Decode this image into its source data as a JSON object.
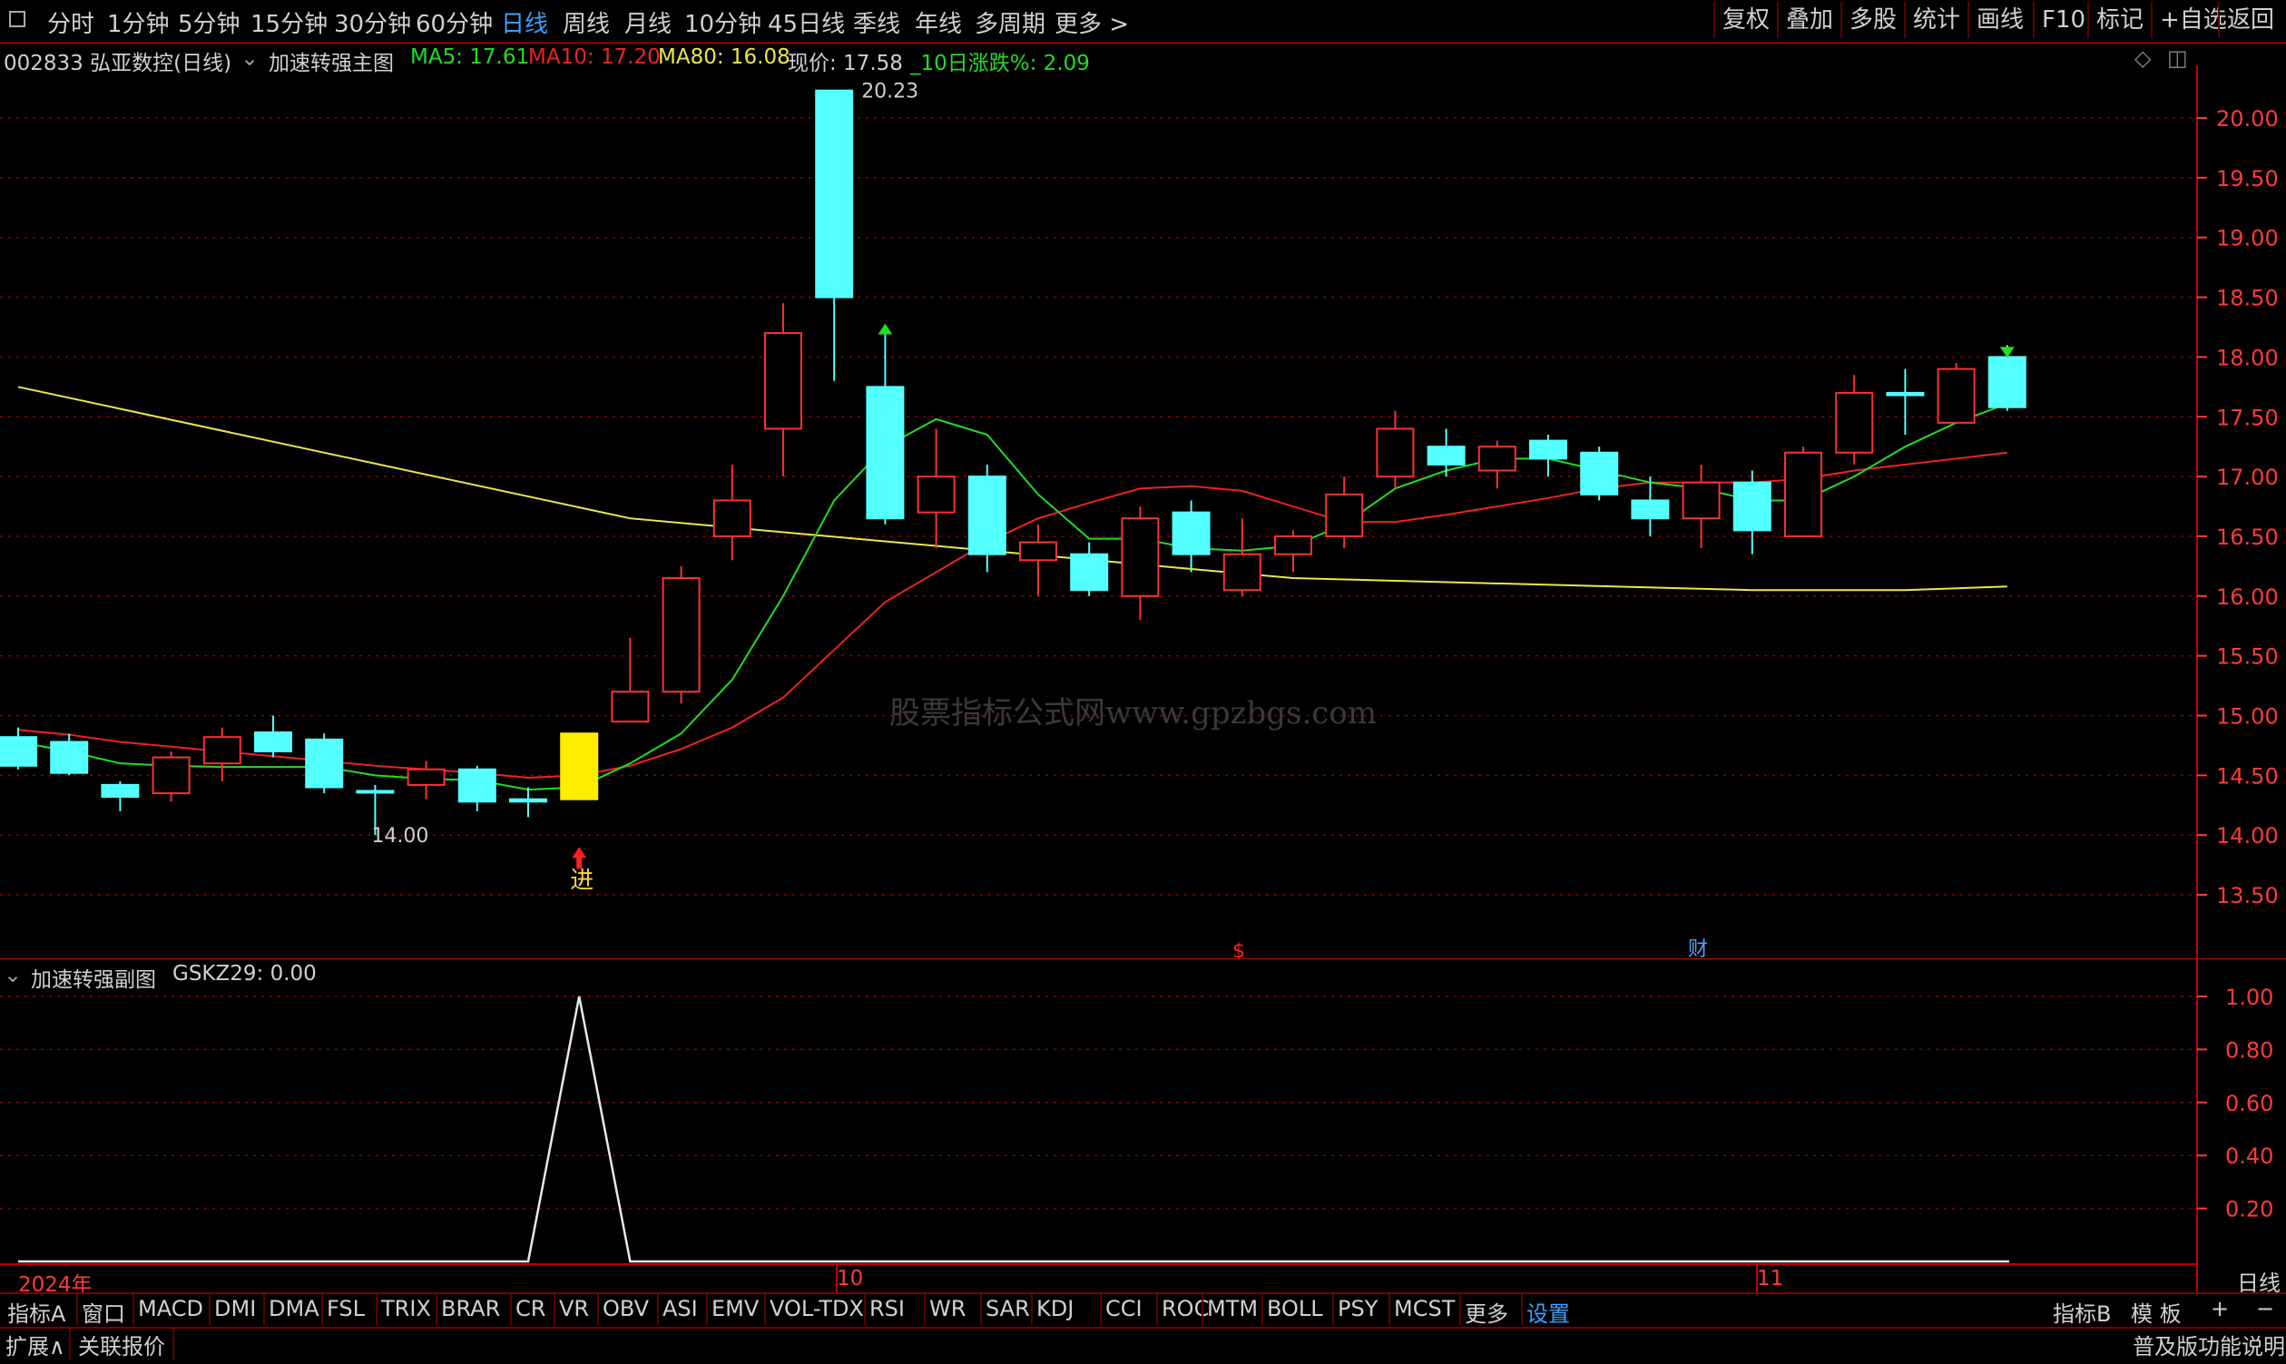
{
  "toolbar": {
    "periods": [
      "分时",
      "1分钟",
      "5分钟",
      "15分钟",
      "30分钟",
      "60分钟",
      "日线",
      "周线",
      "月线",
      "10分钟",
      "45日线",
      "季线",
      "年线",
      "多周期",
      "更多 >"
    ],
    "active_period": "日线",
    "right": [
      "复权",
      "叠加",
      "多股",
      "统计",
      "画线",
      "F10",
      "标记",
      "+自选",
      "返回"
    ]
  },
  "info": {
    "stock": "002833 弘亚数控(日线)",
    "formula": "加速转强主图",
    "ma5": "MA5: 17.61",
    "ma10": "MA10: 17.20",
    "ma80": "MA80: 16.08",
    "price": "现价: 17.58",
    "change": "_10日涨跌%: 2.09"
  },
  "colors": {
    "up": "#ff3030",
    "down": "#54ffff",
    "ma5": "#22dd22",
    "ma10": "#ee2222",
    "ma80": "#e8e84a",
    "grid": "#8a0000",
    "axis": "#ff3a3a",
    "signal": "#ffee00"
  },
  "annotations": {
    "high": "20.23",
    "low": "←14.00",
    "buy_label": "进",
    "event_s": "$",
    "event_cai": "财",
    "watermark": "股票指标公式网www.gpzbgs.com"
  },
  "sub": {
    "title": "加速转强副图",
    "value": "GSKZ29: 0.00"
  },
  "xaxis": {
    "year": "2024年",
    "oct": "10",
    "nov": "11",
    "period": "日线"
  },
  "tabs": [
    "指标A",
    "窗口",
    "MACD",
    "DMI",
    "DMA",
    "FSL",
    "TRIX",
    "BRAR",
    "CR",
    "VR",
    "OBV",
    "ASI",
    "EMV",
    "VOL-TDX",
    "RSI",
    "WR",
    "SAR",
    "KDJ",
    "CCI",
    "ROC",
    "MTM",
    "BOLL",
    "PSY",
    "MCST",
    "更多",
    "设置"
  ],
  "tab_right": [
    "指标B",
    "模 板",
    "+",
    "−"
  ],
  "status": {
    "expand": "扩展∧",
    "linked": "关联报价",
    "right": "普及版功能说明"
  },
  "chart_data": [
    {
      "type": "candlestick",
      "title": "002833 弘亚数控(日线)",
      "ylim": [
        13.2,
        20.6
      ],
      "yticks": [
        "20.00",
        "19.50",
        "19.00",
        "18.50",
        "18.00",
        "17.50",
        "17.00",
        "16.50",
        "16.00",
        "15.50",
        "15.00",
        "14.50",
        "14.00",
        "13.50"
      ],
      "candles": [
        {
          "o": 14.82,
          "h": 14.9,
          "l": 14.55,
          "c": 14.58
        },
        {
          "o": 14.78,
          "h": 14.85,
          "l": 14.5,
          "c": 14.52
        },
        {
          "o": 14.42,
          "h": 14.45,
          "l": 14.2,
          "c": 14.32
        },
        {
          "o": 14.35,
          "h": 14.7,
          "l": 14.28,
          "c": 14.65
        },
        {
          "o": 14.6,
          "h": 14.9,
          "l": 14.45,
          "c": 14.82
        },
        {
          "o": 14.86,
          "h": 15.0,
          "l": 14.65,
          "c": 14.7
        },
        {
          "o": 14.8,
          "h": 14.85,
          "l": 14.35,
          "c": 14.4
        },
        {
          "o": 14.37,
          "h": 14.42,
          "l": 14.0,
          "c": 14.36
        },
        {
          "o": 14.42,
          "h": 14.62,
          "l": 14.3,
          "c": 14.55
        },
        {
          "o": 14.55,
          "h": 14.58,
          "l": 14.2,
          "c": 14.28
        },
        {
          "o": 14.3,
          "h": 14.4,
          "l": 14.15,
          "c": 14.28
        },
        {
          "o": 14.85,
          "h": 14.85,
          "l": 14.3,
          "c": 14.3,
          "signal": true
        },
        {
          "o": 14.95,
          "h": 15.65,
          "l": 14.95,
          "c": 15.2
        },
        {
          "o": 15.2,
          "h": 16.25,
          "l": 15.1,
          "c": 16.15
        },
        {
          "o": 16.5,
          "h": 17.1,
          "l": 16.3,
          "c": 16.8
        },
        {
          "o": 17.4,
          "h": 18.45,
          "l": 17.0,
          "c": 18.2
        },
        {
          "o": 20.23,
          "h": 20.23,
          "l": 17.8,
          "c": 18.5
        },
        {
          "o": 17.75,
          "h": 18.25,
          "l": 16.6,
          "c": 16.65
        },
        {
          "o": 16.7,
          "h": 17.4,
          "l": 16.4,
          "c": 17.0
        },
        {
          "o": 17.0,
          "h": 17.1,
          "l": 16.2,
          "c": 16.35
        },
        {
          "o": 16.3,
          "h": 16.6,
          "l": 16.0,
          "c": 16.45
        },
        {
          "o": 16.35,
          "h": 16.45,
          "l": 16.0,
          "c": 16.05
        },
        {
          "o": 16.0,
          "h": 16.75,
          "l": 15.8,
          "c": 16.65
        },
        {
          "o": 16.7,
          "h": 16.8,
          "l": 16.2,
          "c": 16.35
        },
        {
          "o": 16.05,
          "h": 16.65,
          "l": 16.0,
          "c": 16.35
        },
        {
          "o": 16.35,
          "h": 16.55,
          "l": 16.2,
          "c": 16.5
        },
        {
          "o": 16.5,
          "h": 17.0,
          "l": 16.4,
          "c": 16.85
        },
        {
          "o": 17.0,
          "h": 17.55,
          "l": 16.9,
          "c": 17.4
        },
        {
          "o": 17.25,
          "h": 17.4,
          "l": 17.0,
          "c": 17.1
        },
        {
          "o": 17.05,
          "h": 17.3,
          "l": 16.9,
          "c": 17.25
        },
        {
          "o": 17.3,
          "h": 17.35,
          "l": 17.0,
          "c": 17.15
        },
        {
          "o": 17.2,
          "h": 17.25,
          "l": 16.8,
          "c": 16.85
        },
        {
          "o": 16.8,
          "h": 17.0,
          "l": 16.5,
          "c": 16.65
        },
        {
          "o": 16.65,
          "h": 17.1,
          "l": 16.4,
          "c": 16.95
        },
        {
          "o": 16.95,
          "h": 17.05,
          "l": 16.35,
          "c": 16.55
        },
        {
          "o": 16.5,
          "h": 17.25,
          "l": 16.5,
          "c": 17.2
        },
        {
          "o": 17.2,
          "h": 17.85,
          "l": 17.1,
          "c": 17.7
        },
        {
          "o": 17.7,
          "h": 17.9,
          "l": 17.35,
          "c": 17.68
        },
        {
          "o": 17.45,
          "h": 17.95,
          "l": 17.45,
          "c": 17.9
        },
        {
          "o": 18.0,
          "h": 18.1,
          "l": 17.55,
          "c": 17.58
        }
      ],
      "ma5": [
        14.78,
        14.7,
        14.6,
        14.58,
        14.57,
        14.57,
        14.57,
        14.5,
        14.47,
        14.46,
        14.38,
        14.4,
        14.6,
        14.85,
        15.3,
        16.0,
        16.8,
        17.25,
        17.48,
        17.35,
        16.85,
        16.48,
        16.48,
        16.4,
        16.38,
        16.42,
        16.6,
        16.9,
        17.05,
        17.15,
        17.15,
        17.05,
        16.95,
        16.9,
        16.8,
        16.8,
        17.0,
        17.25,
        17.45,
        17.61
      ],
      "ma10": [
        14.88,
        14.84,
        14.78,
        14.74,
        14.7,
        14.66,
        14.62,
        14.58,
        14.55,
        14.52,
        14.48,
        14.5,
        14.58,
        14.72,
        14.9,
        15.15,
        15.55,
        15.95,
        16.2,
        16.45,
        16.65,
        16.78,
        16.9,
        16.92,
        16.88,
        16.75,
        16.62,
        16.62,
        16.68,
        16.75,
        16.82,
        16.9,
        16.95,
        16.95,
        16.95,
        16.98,
        17.05,
        17.1,
        17.15,
        17.2
      ],
      "ma80": [
        {
          "x": 0,
          "y": 17.75
        },
        {
          "x": 12,
          "y": 16.65
        },
        {
          "x": 25,
          "y": 16.15
        },
        {
          "x": 34,
          "y": 16.05
        },
        {
          "x": 37,
          "y": 16.05
        },
        {
          "x": 39,
          "y": 16.08
        }
      ],
      "high_label": "20.23",
      "low_label": "14.00"
    },
    {
      "type": "line",
      "title": "加速转强副图",
      "series": [
        {
          "name": "GSKZ29",
          "values": [
            0,
            0,
            0,
            0,
            0,
            0,
            0,
            0,
            0,
            0,
            0,
            1,
            0,
            0,
            0,
            0,
            0,
            0,
            0,
            0,
            0,
            0,
            0,
            0,
            0,
            0,
            0,
            0,
            0,
            0,
            0,
            0,
            0,
            0,
            0,
            0,
            0,
            0,
            0,
            0
          ]
        }
      ],
      "ylim": [
        0,
        1.1
      ],
      "yticks": [
        "1.00",
        "0.80",
        "0.60",
        "0.40",
        "0.20"
      ]
    }
  ]
}
